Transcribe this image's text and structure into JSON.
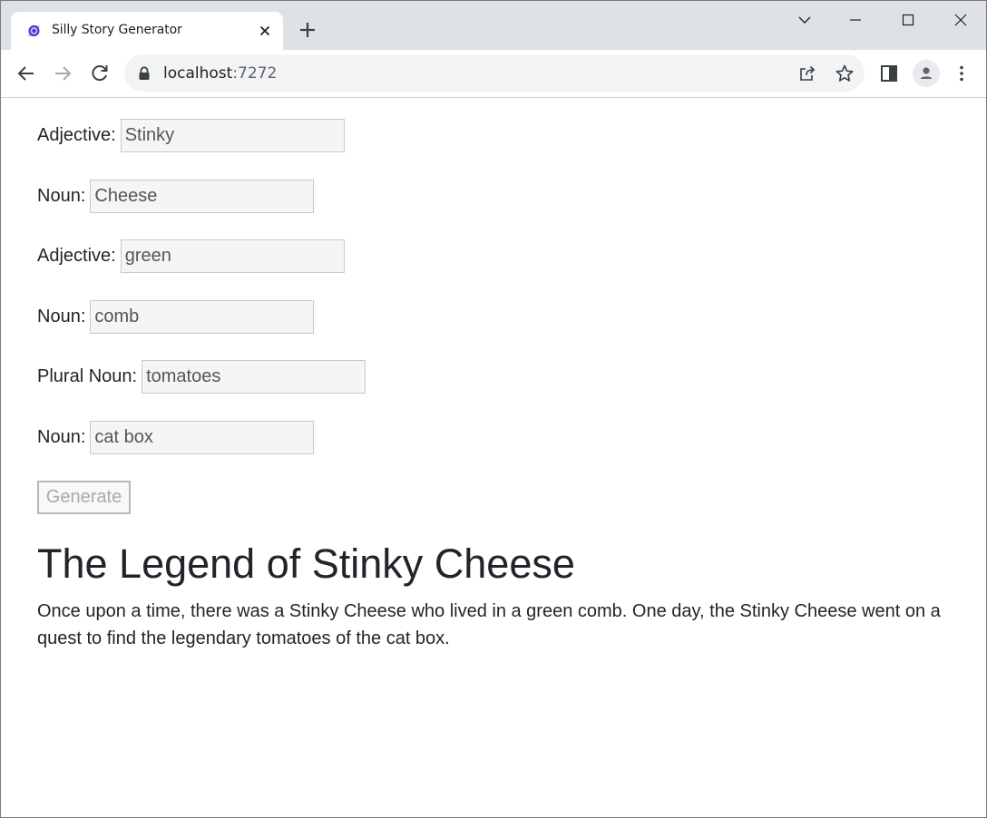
{
  "browser": {
    "tab_title": "Silly Story Generator",
    "url_host": "localhost",
    "url_port": ":7272"
  },
  "form": {
    "fields": [
      {
        "label": "Adjective:",
        "value": "Stinky"
      },
      {
        "label": "Noun:",
        "value": "Cheese"
      },
      {
        "label": "Adjective:",
        "value": "green"
      },
      {
        "label": "Noun:",
        "value": "comb"
      },
      {
        "label": "Plural Noun:",
        "value": "tomatoes"
      },
      {
        "label": "Noun:",
        "value": "cat box"
      }
    ],
    "generate_label": "Generate"
  },
  "story": {
    "title": "The Legend of Stinky Cheese",
    "text": "Once upon a time, there was a Stinky Cheese who lived in a green comb. One day, the Stinky Cheese went on a quest to find the legendary tomatoes of the cat box."
  },
  "colors": {
    "tabstrip": "#dee1e6",
    "omnibox": "#f1f3f4",
    "text": "#212529",
    "favicon": "#512bd4"
  },
  "icons": [
    "blazor-favicon",
    "close-icon",
    "plus-icon",
    "chevron-down-icon",
    "minimize-icon",
    "maximize-icon",
    "close-window-icon",
    "back-arrow-icon",
    "forward-arrow-icon",
    "reload-icon",
    "lock-icon",
    "share-icon",
    "star-icon",
    "side-panel-icon",
    "profile-icon",
    "more-vert-icon"
  ]
}
